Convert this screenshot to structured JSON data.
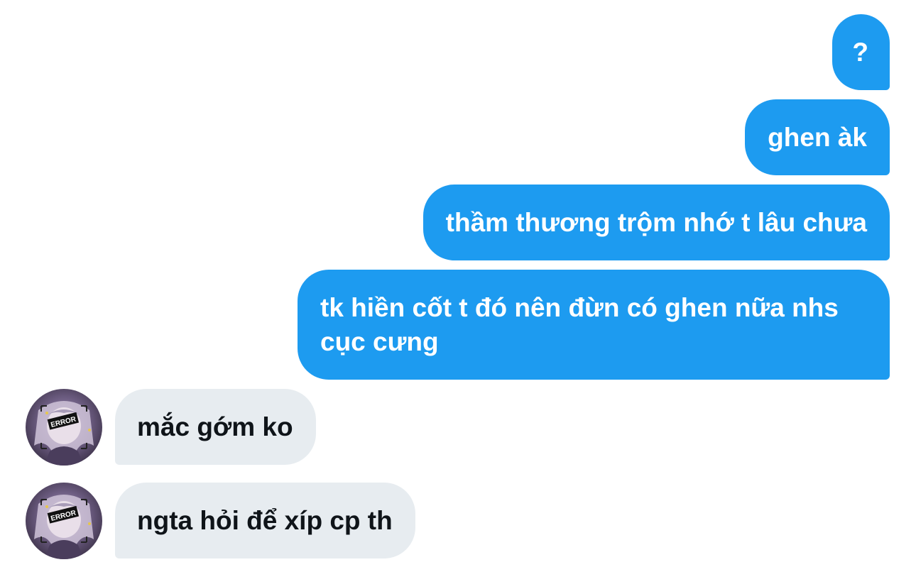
{
  "conversation": {
    "messages": [
      {
        "side": "sent",
        "text": "?"
      },
      {
        "side": "sent",
        "text": "ghen àk"
      },
      {
        "side": "sent",
        "text": "thầm thương trộm nhớ t lâu chưa"
      },
      {
        "side": "sent",
        "text": "tk hiền cốt t đó nên đừn có ghen nữa nhs cục cưng"
      },
      {
        "side": "received",
        "text": "mắc gớm ko"
      },
      {
        "side": "received",
        "text": "ngta hỏi để xíp cp th"
      }
    ],
    "avatar": {
      "icon": "anime-girl-avatar-icon",
      "badge_text": "ERROR"
    }
  },
  "colors": {
    "sent_bubble": "#1d9bf0",
    "received_bubble": "#e7ecf0",
    "sent_text": "#ffffff",
    "received_text": "#0f1419",
    "background": "#ffffff"
  }
}
